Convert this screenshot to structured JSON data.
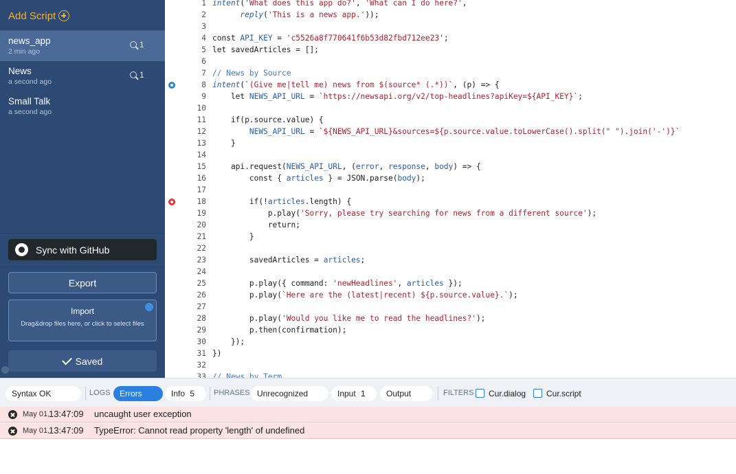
{
  "sidebar": {
    "add_script": "Add Script",
    "scripts": [
      {
        "name": "news_app",
        "time": "2 min ago",
        "count": "1",
        "active": true
      },
      {
        "name": "News",
        "time": "a second ago",
        "count": "1",
        "active": false
      },
      {
        "name": "Small Talk",
        "time": "a second ago",
        "count": "",
        "active": false
      }
    ],
    "github_label": "Sync with GitHub",
    "export_label": "Export",
    "import_title": "Import",
    "import_hint": "Drag&drop files here, or click to select files",
    "saved_label": "Saved"
  },
  "editor": {
    "lines": [
      {
        "n": "1",
        "text": "intent('What does this app do?', 'What can I do here?',"
      },
      {
        "n": "2",
        "text": "      reply('This is a news app.'));"
      },
      {
        "n": "3",
        "text": ""
      },
      {
        "n": "4",
        "text": "const API_KEY = 'c5526a8f770641f6b53d82fbd712ee23';"
      },
      {
        "n": "5",
        "text": "let savedArticles = [];"
      },
      {
        "n": "6",
        "text": ""
      },
      {
        "n": "7",
        "text": "// News by Source"
      },
      {
        "n": "8",
        "text": "intent(`(Give me|tell me) news from $(source* (.*))`, (p) => {",
        "marker": "info"
      },
      {
        "n": "9",
        "text": "    let NEWS_API_URL = `https://newsapi.org/v2/top-headlines?apiKey=${API_KEY}`;"
      },
      {
        "n": "10",
        "text": ""
      },
      {
        "n": "11",
        "text": "    if(p.source.value) {"
      },
      {
        "n": "12",
        "text": "        NEWS_API_URL = `${NEWS_API_URL}&sources=${p.source.value.toLowerCase().split(\" \").join('-')}`"
      },
      {
        "n": "13",
        "text": "    }"
      },
      {
        "n": "14",
        "text": ""
      },
      {
        "n": "15",
        "text": "    api.request(NEWS_API_URL, (error, response, body) => {"
      },
      {
        "n": "16",
        "text": "        const { articles } = JSON.parse(body);"
      },
      {
        "n": "17",
        "text": ""
      },
      {
        "n": "18",
        "text": "        if(!articles.length) {",
        "marker": "error"
      },
      {
        "n": "19",
        "text": "            p.play('Sorry, please try searching for news from a different source');"
      },
      {
        "n": "20",
        "text": "            return;"
      },
      {
        "n": "21",
        "text": "        }"
      },
      {
        "n": "22",
        "text": ""
      },
      {
        "n": "23",
        "text": "        savedArticles = articles;"
      },
      {
        "n": "24",
        "text": ""
      },
      {
        "n": "25",
        "text": "        p.play({ command: 'newHeadlines', articles });"
      },
      {
        "n": "26",
        "text": "        p.play(`Here are the (latest|recent) ${p.source.value}.`);"
      },
      {
        "n": "27",
        "text": ""
      },
      {
        "n": "28",
        "text": "        p.play('Would you like me to read the headlines?');"
      },
      {
        "n": "29",
        "text": "        p.then(confirmation);"
      },
      {
        "n": "30",
        "text": "    });"
      },
      {
        "n": "31",
        "text": "})"
      },
      {
        "n": "32",
        "text": ""
      },
      {
        "n": "33",
        "text": "// News by Term"
      }
    ]
  },
  "bottombar": {
    "syntax": "Syntax OK",
    "logs_label": "LOGS",
    "errors": "Errors",
    "info": "Info",
    "info_count": "5",
    "phrases_label": "PHRASES",
    "unrecognized": "Unrecognized",
    "input": "Input",
    "input_count": "1",
    "output": "Output",
    "filters_label": "FILTERS",
    "cur_dialog": "Cur.dialog",
    "cur_script": "Cur.script"
  },
  "log": [
    {
      "date": "May 01,",
      "time": "13:47:09",
      "message": "uncaught user exception"
    },
    {
      "date": "May 01,",
      "time": "13:47:09",
      "message": "TypeError: Cannot read property 'length' of undefined"
    }
  ],
  "colors": {
    "sidebar_bg": "#2c4a74",
    "accent_orange": "#f2b233",
    "accent_blue": "#2b7fe0",
    "error_bg": "#fbe3e3"
  }
}
